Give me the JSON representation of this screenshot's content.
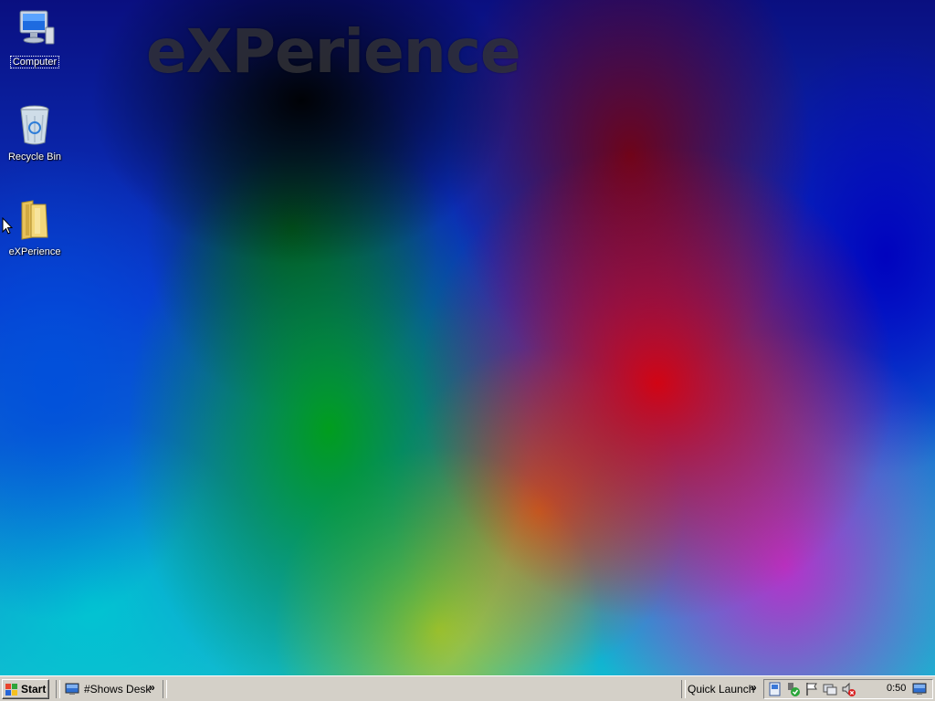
{
  "wallpaper": {
    "title": "eXPerience"
  },
  "desktop": {
    "icons": [
      {
        "label": "Computer",
        "icon": "computer-icon",
        "selected": true
      },
      {
        "label": "Recycle Bin",
        "icon": "recycle-bin-icon"
      },
      {
        "label": "eXPerience",
        "icon": "folder-icon"
      }
    ]
  },
  "taskbar": {
    "start_label": "Start",
    "toolbar_label": "#Shows Desk",
    "quick_launch_label": "Quick Launch",
    "overflow_glyph": "»",
    "tray": {
      "icons": [
        "network-icon",
        "security-shield-icon",
        "flag-icon",
        "display-icon",
        "volume-muted-icon"
      ],
      "clock": "0:50",
      "show_desktop_icon": "show-desktop-icon"
    }
  }
}
